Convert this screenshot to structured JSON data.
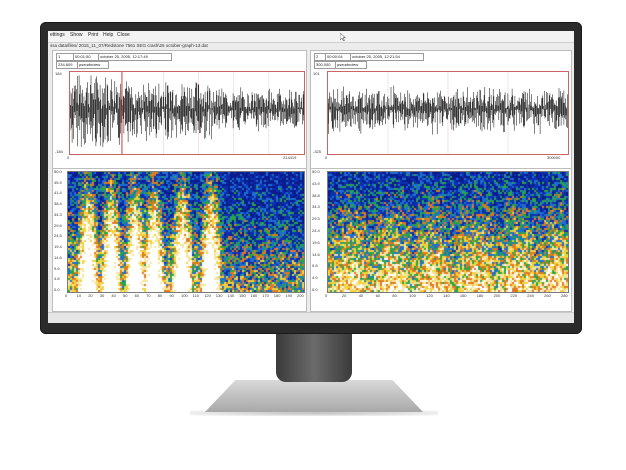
{
  "menu": {
    "items": [
      "ettings",
      "Show",
      "Print",
      "Help",
      "Close"
    ]
  },
  "file_path": "ssa data/files/ 2015_11_07/Redstone 7561 SEG crash\\25 october-graph-13.dat",
  "left_panel": {
    "channel_id": "1",
    "time_field": "00:01:50",
    "date_field": "october 25, 2005, 12:17:49",
    "offset_field": "234.609",
    "mode_label": "pseudoview",
    "y_max": "184",
    "y_min": "-184",
    "x_min": "0",
    "x_max": "214419",
    "spec_y_ticks": [
      "50.0",
      "45.9",
      "41.4",
      "38.4",
      "34.3",
      "29.6",
      "24.5",
      "19.4",
      "14.6",
      "9.6",
      "4.8",
      "0.0"
    ],
    "spec_x_ticks": [
      "0",
      "10",
      "20",
      "30",
      "40",
      "50",
      "60",
      "70",
      "80",
      "90",
      "100",
      "110",
      "120",
      "130",
      "140",
      "150",
      "160",
      "170",
      "180",
      "190",
      "200"
    ]
  },
  "right_panel": {
    "channel_id": "2",
    "time_field": "00:00:04",
    "date_field": "october 25, 2005, 12:21:54",
    "offset_field": "300.000",
    "mode_label": "pseudoview",
    "y_max": "101",
    "y_min": "-325",
    "x_min": "0",
    "x_max": "300000",
    "spec_y_ticks": [
      "50.0",
      "43.9",
      "38.8",
      "34.3",
      "29.3",
      "24.4",
      "19.6",
      "14.6",
      "9.8",
      "4.9",
      "0.0"
    ],
    "spec_x_ticks": [
      "0",
      "20",
      "40",
      "60",
      "80",
      "100",
      "120",
      "140",
      "160",
      "180",
      "200",
      "220",
      "240",
      "260",
      "280"
    ]
  },
  "colors": {
    "bezel": "#2b2b2b",
    "spec_low": "#0a1a8c",
    "spec_mid": "#2aa34a",
    "spec_high": "#f2d23a",
    "spec_peak": "#ffffff",
    "marker": "#cc2222"
  }
}
